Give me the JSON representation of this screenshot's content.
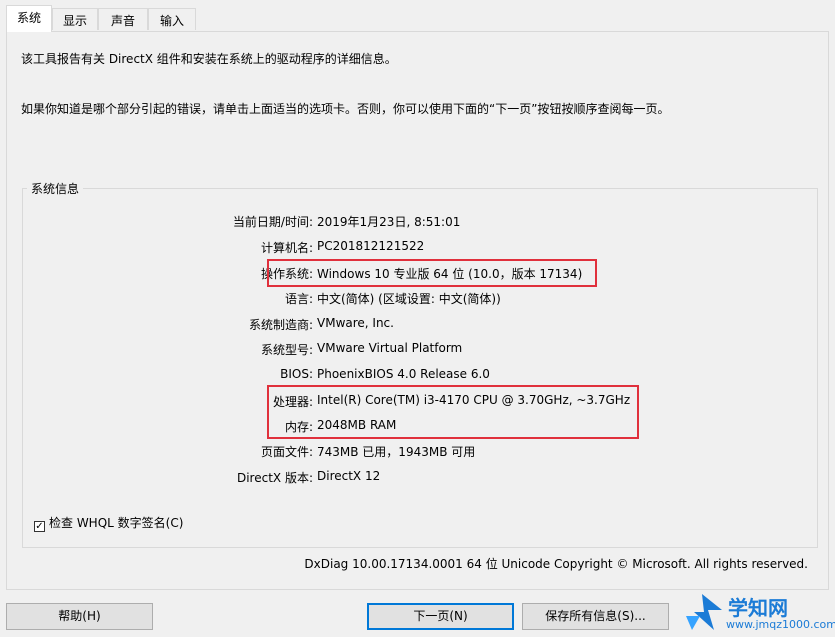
{
  "tabs": [
    {
      "label": "系统",
      "active": true
    },
    {
      "label": "显示",
      "active": false
    },
    {
      "label": "声音",
      "active": false
    },
    {
      "label": "输入",
      "active": false
    }
  ],
  "intro": {
    "line1": "该工具报告有关 DirectX 组件和安装在系统上的驱动程序的详细信息。",
    "line2": "如果你知道是哪个部分引起的错误，请单击上面适当的选项卡。否则，你可以使用下面的“下一页”按钮按顺序查阅每一页。"
  },
  "system_info": {
    "title": "系统信息",
    "rows": [
      {
        "label": "当前日期/时间:",
        "value": "2019年1月23日, 8:51:01"
      },
      {
        "label": "计算机名:",
        "value": "PC201812121522"
      },
      {
        "label": "操作系统:",
        "value": "Windows 10 专业版 64 位 (10.0，版本 17134)"
      },
      {
        "label": "语言:",
        "value": "中文(简体) (区域设置: 中文(简体))"
      },
      {
        "label": "系统制造商:",
        "value": "VMware, Inc."
      },
      {
        "label": "系统型号:",
        "value": "VMware Virtual Platform"
      },
      {
        "label": "BIOS:",
        "value": "PhoenixBIOS 4.0 Release 6.0"
      },
      {
        "label": "处理器:",
        "value": "Intel(R) Core(TM) i3-4170 CPU @ 3.70GHz, ~3.7GHz"
      },
      {
        "label": "内存:",
        "value": "2048MB RAM"
      },
      {
        "label": "页面文件:",
        "value": "743MB 已用，1943MB 可用"
      },
      {
        "label": "DirectX 版本:",
        "value": "DirectX 12"
      }
    ]
  },
  "whql_checkbox": {
    "label": "检查 WHQL 数字签名(C)",
    "checked": true,
    "glyph": "✓"
  },
  "footer": "DxDiag 10.00.17134.0001 64 位 Unicode  Copyright © Microsoft. All rights reserved.",
  "buttons": {
    "help": "帮助(H)",
    "next": "下一页(N)",
    "save": "保存所有信息(S)..."
  },
  "watermark": {
    "name": "学知网",
    "url": "www.jmqz1000.com",
    "accent": "#1b7bd6"
  },
  "colors": {
    "highlight": "#e0303c",
    "default_button_border": "#0078d7"
  }
}
